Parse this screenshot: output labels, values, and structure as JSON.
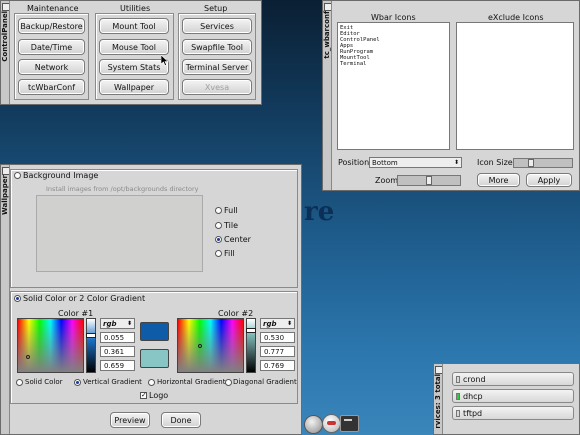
{
  "control_panel": {
    "title": "ControlPanel",
    "groups": [
      {
        "label": "Maintenance",
        "buttons": [
          "Backup/Restore",
          "Date/Time",
          "Network",
          "tcWbarConf"
        ]
      },
      {
        "label": "Utilities",
        "buttons": [
          "Mount Tool",
          "Mouse Tool",
          "System Stats",
          "Wallpaper"
        ]
      },
      {
        "label": "Setup",
        "buttons": [
          "Services",
          "Swapfile Tool",
          "Terminal Server",
          "Xvesa"
        ]
      }
    ]
  },
  "wbar_conf": {
    "title": "tc_wbarconf",
    "wbar_icons_label": "Wbar Icons",
    "exclude_icons_label": "eXclude Icons",
    "wbar_icons": [
      "Exit",
      "Editor",
      "ControlPanel",
      "Apps",
      "RunProgram",
      "MountTool",
      "Terminal"
    ],
    "exclude_icons": [],
    "position_label": "Position",
    "position_value": "Bottom",
    "icon_size_label": "Icon Size",
    "zoom_label": "Zoom",
    "more_label": "More",
    "apply_label": "Apply"
  },
  "wallpaper": {
    "title": "Wallpaper",
    "bg_image_label": "Background Image",
    "install_hint": "Install images from /opt/backgrounds directory",
    "layout_options": [
      "Full",
      "Tile",
      "Center",
      "Fill"
    ],
    "layout_selected": "Center",
    "solid_label": "Solid Color or 2 Color Gradient",
    "color1_label": "Color #1",
    "color2_label": "Color #2",
    "mode": "rgb",
    "color1_values": [
      "0.055",
      "0.361",
      "0.659"
    ],
    "color2_values": [
      "0.530",
      "0.777",
      "0.769"
    ],
    "color1_hex": "#0e5ca8",
    "color2_hex": "#87c6c4",
    "gradient_options": [
      "Solid Color",
      "Vertical Gradient",
      "Horizontal Gradient",
      "Diagonal Gradient"
    ],
    "gradient_selected": "Vertical Gradient",
    "logo_label": "Logo",
    "logo_checked": true,
    "preview_label": "Preview",
    "done_label": "Done"
  },
  "services": {
    "title": "rvices: 3 total",
    "items": [
      {
        "name": "crond",
        "running": false
      },
      {
        "name": "dhcp",
        "running": true
      },
      {
        "name": "tftpd",
        "running": false
      }
    ]
  },
  "desktop_fragment": "re"
}
